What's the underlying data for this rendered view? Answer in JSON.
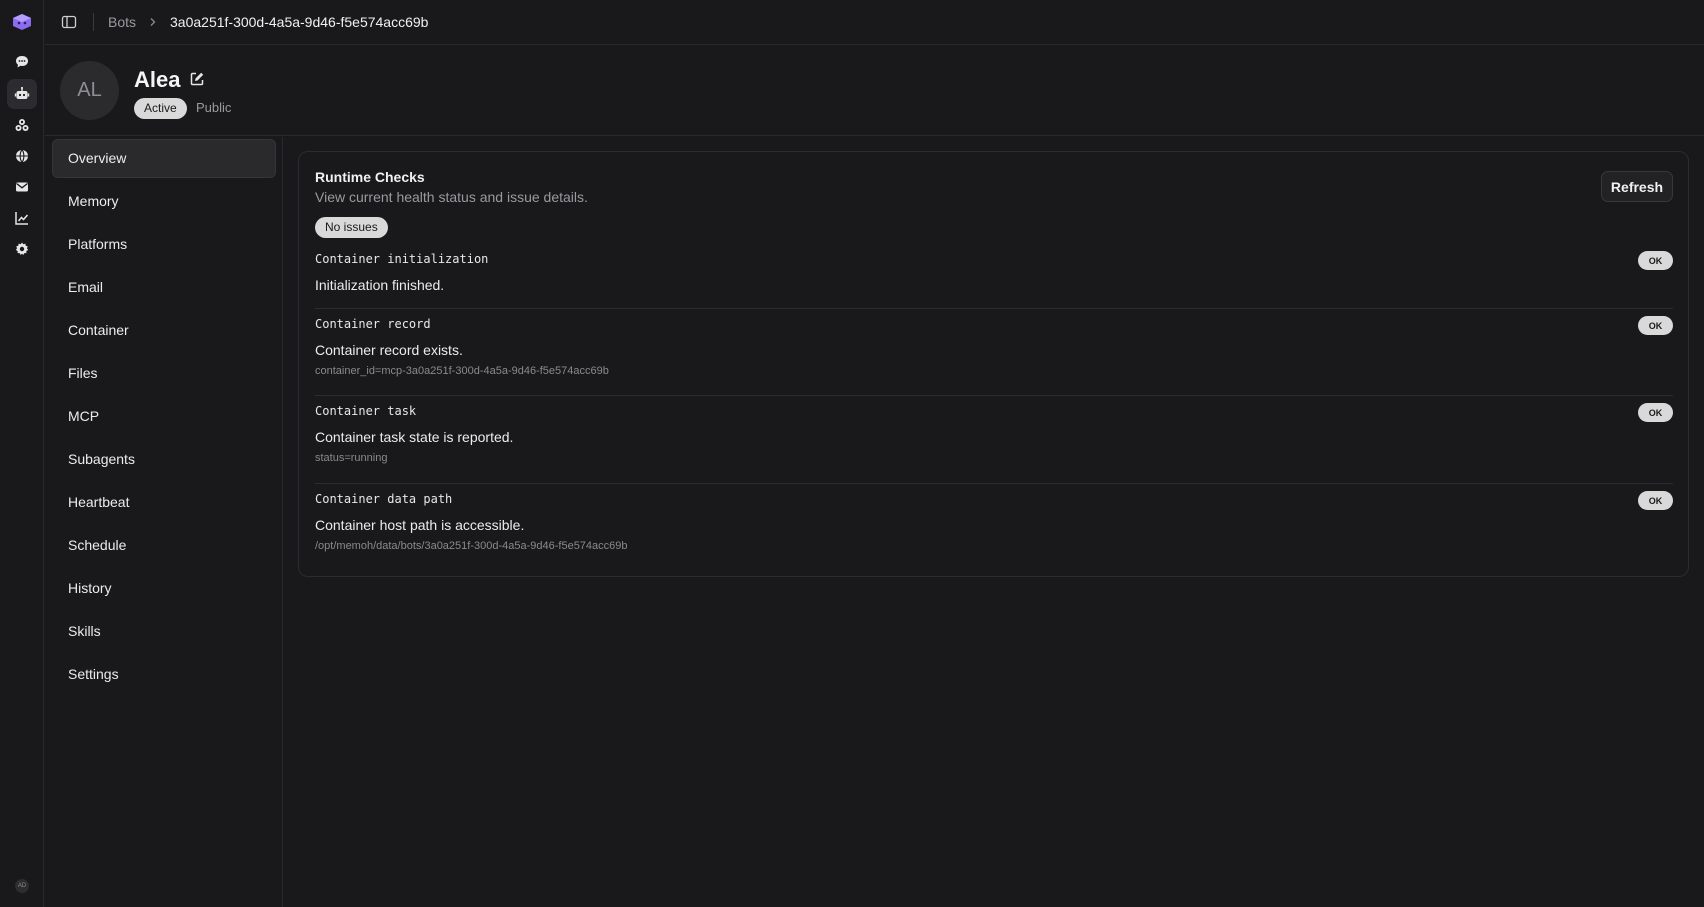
{
  "rail": {
    "logo": "app-logo",
    "items": [
      {
        "icon": "chat-icon"
      },
      {
        "icon": "bot-icon",
        "active": true
      },
      {
        "icon": "models-icon"
      },
      {
        "icon": "globe-icon"
      },
      {
        "icon": "mail-icon"
      },
      {
        "icon": "chart-icon"
      },
      {
        "icon": "gear-icon"
      }
    ],
    "user_initials": "AD"
  },
  "topbar": {
    "crumb_root": "Bots",
    "crumb_current": "3a0a251f-300d-4a5a-9d46-f5e574acc69b"
  },
  "bot": {
    "initials": "AL",
    "name": "Alea",
    "status": "Active",
    "visibility": "Public"
  },
  "nav": {
    "items": [
      "Overview",
      "Memory",
      "Platforms",
      "Email",
      "Container",
      "Files",
      "MCP",
      "Subagents",
      "Heartbeat",
      "Schedule",
      "History",
      "Skills",
      "Settings"
    ],
    "active": "Overview"
  },
  "runtime": {
    "title": "Runtime Checks",
    "subtitle": "View current health status and issue details.",
    "refresh_label": "Refresh",
    "issues_badge": "No issues",
    "checks": [
      {
        "name": "Container initialization",
        "message": "Initialization finished.",
        "detail": "",
        "status": "OK"
      },
      {
        "name": "Container record",
        "message": "Container record exists.",
        "detail": "container_id=mcp-3a0a251f-300d-4a5a-9d46-f5e574acc69b",
        "status": "OK"
      },
      {
        "name": "Container task",
        "message": "Container task state is reported.",
        "detail": "status=running",
        "status": "OK"
      },
      {
        "name": "Container data path",
        "message": "Container host path is accessible.",
        "detail": "/opt/memoh/data/bots/3a0a251f-300d-4a5a-9d46-f5e574acc69b",
        "status": "OK"
      }
    ]
  },
  "colors": {
    "background": "#19191b",
    "border": "#2a2a2d",
    "badge": "#d9d9d9",
    "logo": "#8b6cf0"
  }
}
